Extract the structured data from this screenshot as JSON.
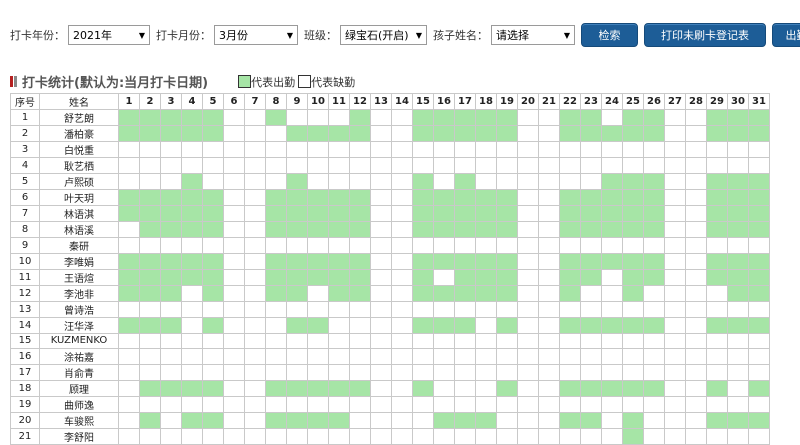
{
  "filters": {
    "year_label": "打卡年份：",
    "year_value": "2021年",
    "month_label": "打卡月份：",
    "month_value": "3月份",
    "class_label": "班级：",
    "class_value": "绿宝石(开启)",
    "child_label": "孩子姓名：",
    "child_value": "请选择"
  },
  "buttons": {
    "search": "检索",
    "print": "打印未刷卡登记表",
    "attendance": "出勤登"
  },
  "stats": {
    "title": "打卡统计(默认为:当月打卡日期)",
    "legend_present": "代表出勤",
    "legend_absent": "代表缺勤",
    "colors": {
      "present": "#a6e5a6",
      "absent": "#ffffff",
      "icon_red": "#b52020",
      "icon_gray": "#888888"
    }
  },
  "table": {
    "index_header": "序号",
    "name_header": "姓名",
    "days": [
      "1",
      "2",
      "3",
      "4",
      "5",
      "6",
      "7",
      "8",
      "9",
      "10",
      "11",
      "12",
      "13",
      "14",
      "15",
      "16",
      "17",
      "18",
      "19",
      "20",
      "21",
      "22",
      "23",
      "24",
      "25",
      "26",
      "27",
      "28",
      "29",
      "30",
      "31"
    ],
    "rows": [
      {
        "index": "1",
        "name": "舒艺朗",
        "attendance": [
          1,
          1,
          1,
          1,
          1,
          0,
          0,
          1,
          0,
          0,
          0,
          1,
          0,
          0,
          1,
          1,
          1,
          1,
          1,
          0,
          0,
          1,
          1,
          0,
          1,
          1,
          0,
          0,
          1,
          1,
          1
        ]
      },
      {
        "index": "2",
        "name": "潘柏豪",
        "attendance": [
          1,
          1,
          1,
          1,
          1,
          0,
          0,
          0,
          1,
          1,
          1,
          1,
          0,
          0,
          1,
          1,
          1,
          1,
          1,
          0,
          0,
          1,
          1,
          1,
          1,
          1,
          0,
          0,
          1,
          1,
          1
        ]
      },
      {
        "index": "3",
        "name": "白悦重",
        "attendance": [
          0,
          0,
          0,
          0,
          0,
          0,
          0,
          0,
          0,
          0,
          0,
          0,
          0,
          0,
          0,
          0,
          0,
          0,
          0,
          0,
          0,
          0,
          0,
          0,
          0,
          0,
          0,
          0,
          0,
          0,
          0
        ]
      },
      {
        "index": "4",
        "name": "耿艺栖",
        "attendance": [
          0,
          0,
          0,
          0,
          0,
          0,
          0,
          0,
          0,
          0,
          0,
          0,
          0,
          0,
          0,
          0,
          0,
          0,
          0,
          0,
          0,
          0,
          0,
          0,
          0,
          0,
          0,
          0,
          0,
          0,
          0
        ]
      },
      {
        "index": "5",
        "name": "卢熙硕",
        "attendance": [
          0,
          0,
          0,
          1,
          0,
          0,
          0,
          0,
          1,
          0,
          0,
          0,
          0,
          0,
          1,
          0,
          1,
          0,
          0,
          0,
          0,
          0,
          0,
          1,
          1,
          1,
          0,
          0,
          1,
          1,
          1
        ]
      },
      {
        "index": "6",
        "name": "叶天玥",
        "attendance": [
          1,
          1,
          1,
          1,
          1,
          0,
          0,
          1,
          1,
          1,
          1,
          1,
          0,
          0,
          1,
          1,
          1,
          1,
          1,
          0,
          0,
          1,
          1,
          1,
          1,
          1,
          0,
          0,
          1,
          1,
          1
        ]
      },
      {
        "index": "7",
        "name": "林语淇",
        "attendance": [
          1,
          1,
          1,
          1,
          1,
          0,
          0,
          1,
          1,
          1,
          1,
          1,
          0,
          0,
          1,
          1,
          1,
          1,
          1,
          0,
          0,
          1,
          1,
          1,
          1,
          1,
          0,
          0,
          1,
          1,
          1
        ]
      },
      {
        "index": "8",
        "name": "林语溪",
        "attendance": [
          0,
          1,
          1,
          1,
          1,
          0,
          0,
          1,
          1,
          1,
          1,
          1,
          0,
          0,
          1,
          1,
          1,
          1,
          1,
          0,
          0,
          1,
          1,
          1,
          1,
          1,
          0,
          0,
          1,
          1,
          1
        ]
      },
      {
        "index": "9",
        "name": "秦研",
        "attendance": [
          0,
          0,
          0,
          0,
          0,
          0,
          0,
          0,
          0,
          0,
          0,
          0,
          0,
          0,
          0,
          0,
          0,
          0,
          0,
          0,
          0,
          0,
          0,
          0,
          0,
          0,
          0,
          0,
          0,
          0,
          0
        ]
      },
      {
        "index": "10",
        "name": "李唯娟",
        "attendance": [
          1,
          1,
          1,
          1,
          1,
          0,
          0,
          1,
          1,
          1,
          1,
          1,
          0,
          0,
          1,
          1,
          1,
          1,
          1,
          0,
          0,
          1,
          1,
          1,
          1,
          1,
          0,
          0,
          1,
          1,
          1
        ]
      },
      {
        "index": "11",
        "name": "王语煊",
        "attendance": [
          1,
          1,
          1,
          1,
          1,
          0,
          0,
          1,
          1,
          1,
          1,
          1,
          0,
          0,
          1,
          0,
          1,
          1,
          1,
          0,
          0,
          1,
          1,
          0,
          1,
          1,
          0,
          0,
          1,
          1,
          1
        ]
      },
      {
        "index": "12",
        "name": "李池非",
        "attendance": [
          1,
          1,
          1,
          0,
          1,
          0,
          0,
          1,
          1,
          0,
          1,
          1,
          0,
          0,
          1,
          1,
          1,
          1,
          1,
          0,
          0,
          1,
          0,
          0,
          1,
          0,
          0,
          0,
          0,
          1,
          1
        ]
      },
      {
        "index": "13",
        "name": "曾诗浩",
        "attendance": [
          0,
          0,
          0,
          0,
          0,
          0,
          0,
          0,
          0,
          0,
          0,
          0,
          0,
          0,
          0,
          0,
          0,
          0,
          0,
          0,
          0,
          0,
          0,
          0,
          0,
          0,
          0,
          0,
          0,
          0,
          0
        ]
      },
      {
        "index": "14",
        "name": "汪华泽",
        "attendance": [
          1,
          1,
          1,
          0,
          1,
          0,
          0,
          0,
          1,
          1,
          0,
          0,
          0,
          0,
          1,
          1,
          1,
          0,
          1,
          0,
          0,
          1,
          1,
          1,
          1,
          1,
          0,
          0,
          1,
          1,
          1
        ]
      },
      {
        "index": "15",
        "name": "KUZMENKO",
        "attendance": [
          0,
          0,
          0,
          0,
          0,
          0,
          0,
          0,
          0,
          0,
          0,
          0,
          0,
          0,
          0,
          0,
          0,
          0,
          0,
          0,
          0,
          0,
          0,
          0,
          0,
          0,
          0,
          0,
          0,
          0,
          0
        ]
      },
      {
        "index": "16",
        "name": "涂祐嘉",
        "attendance": [
          0,
          0,
          0,
          0,
          0,
          0,
          0,
          0,
          0,
          0,
          0,
          0,
          0,
          0,
          0,
          0,
          0,
          0,
          0,
          0,
          0,
          0,
          0,
          0,
          0,
          0,
          0,
          0,
          0,
          0,
          0
        ]
      },
      {
        "index": "17",
        "name": "肖俞青",
        "attendance": [
          0,
          0,
          0,
          0,
          0,
          0,
          0,
          0,
          0,
          0,
          0,
          0,
          0,
          0,
          0,
          0,
          0,
          0,
          0,
          0,
          0,
          0,
          0,
          0,
          0,
          0,
          0,
          0,
          0,
          0,
          0
        ]
      },
      {
        "index": "18",
        "name": "顾理",
        "attendance": [
          0,
          1,
          1,
          1,
          1,
          0,
          0,
          1,
          1,
          1,
          1,
          1,
          0,
          0,
          1,
          0,
          0,
          0,
          1,
          0,
          0,
          1,
          1,
          1,
          1,
          1,
          0,
          0,
          1,
          0,
          1
        ]
      },
      {
        "index": "19",
        "name": "曲师逸",
        "attendance": [
          0,
          0,
          0,
          0,
          0,
          0,
          0,
          0,
          0,
          0,
          0,
          0,
          0,
          0,
          0,
          0,
          0,
          0,
          0,
          0,
          0,
          0,
          0,
          0,
          0,
          0,
          0,
          0,
          0,
          0,
          0
        ]
      },
      {
        "index": "20",
        "name": "车骏熙",
        "attendance": [
          0,
          1,
          0,
          1,
          1,
          0,
          0,
          1,
          1,
          1,
          1,
          0,
          0,
          0,
          0,
          1,
          1,
          1,
          0,
          0,
          0,
          1,
          1,
          0,
          1,
          0,
          0,
          0,
          1,
          1,
          1
        ]
      },
      {
        "index": "21",
        "name": "李舒阳",
        "attendance": [
          0,
          0,
          0,
          0,
          0,
          0,
          0,
          0,
          0,
          0,
          0,
          0,
          0,
          0,
          0,
          0,
          0,
          0,
          0,
          0,
          0,
          0,
          0,
          0,
          1,
          0,
          0,
          0,
          0,
          0,
          0
        ]
      }
    ]
  }
}
